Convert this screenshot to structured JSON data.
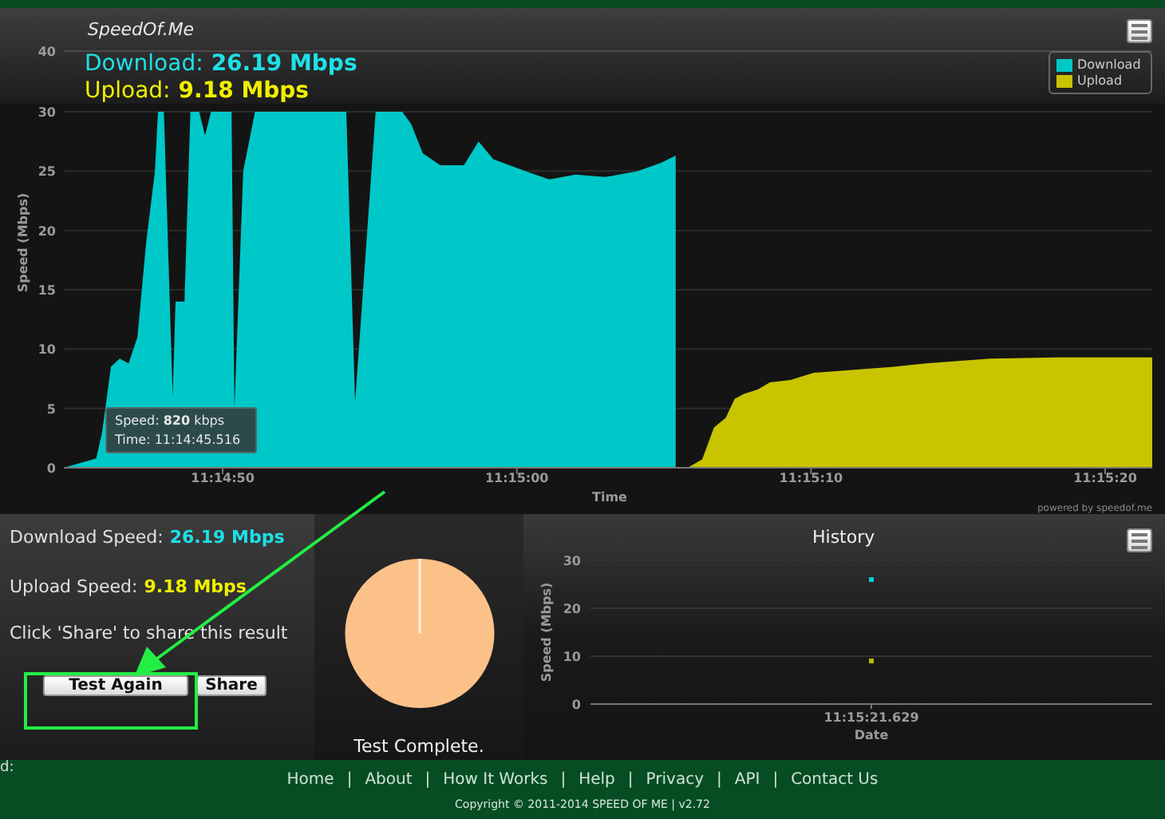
{
  "header": {
    "title": "SpeedOf.Me",
    "download": {
      "label": "Download:",
      "value": "26.19 Mbps"
    },
    "upload": {
      "label": "Upload:",
      "value": "9.18 Mbps"
    }
  },
  "speed_chart": {
    "chart_data": {
      "type": "area",
      "xlabel": "Time",
      "ylabel": "Speed (Mbps)",
      "x": [
        40484.6,
        40485.7,
        40485.9,
        40486.2,
        40486.5,
        40486.8,
        40487.1,
        40487.4,
        40487.7,
        40487.8,
        40488.0,
        40488.3,
        40488.4,
        40488.7,
        40488.9,
        40489.2,
        40489.4,
        40489.6,
        40490.3,
        40490.4,
        40490.7,
        40491.1,
        40494.2,
        40494.5,
        40495.2,
        40496.1,
        40496.4,
        40496.8,
        40497.4,
        40498.2,
        40498.7,
        40499.2,
        40500.3,
        40501.1,
        40502.0,
        40503.0,
        40504.1,
        40504.9,
        40505.4,
        40505.8,
        40506.3,
        40506.7,
        40507.1,
        40507.4,
        40507.7,
        40508.2,
        40508.6,
        40509.3,
        40510.1,
        40511.2,
        40512.8,
        40513.9,
        40515.0,
        40516.1,
        40518.3,
        40521.6
      ],
      "series": [
        {
          "name": "Download",
          "color": "#00c8c8",
          "values": [
            0,
            0.8,
            3,
            8.5,
            9.2,
            8.8,
            11,
            19,
            25,
            30,
            30,
            6,
            14,
            14,
            30,
            30,
            28,
            30,
            30,
            5,
            25,
            30,
            30,
            5.5,
            30,
            30,
            29,
            26.5,
            25.5,
            25.5,
            27.5,
            26,
            25,
            24.3,
            24.7,
            24.5,
            25,
            25.7,
            26.3,
            null,
            null,
            null,
            null,
            null,
            null,
            null,
            null,
            null,
            null,
            null,
            null,
            null,
            null,
            null,
            null,
            null
          ]
        },
        {
          "name": "Upload",
          "color": "#c8c400",
          "values": [
            null,
            null,
            null,
            null,
            null,
            null,
            null,
            null,
            null,
            null,
            null,
            null,
            null,
            null,
            null,
            null,
            null,
            null,
            null,
            null,
            null,
            null,
            null,
            null,
            null,
            null,
            null,
            null,
            null,
            null,
            null,
            null,
            null,
            null,
            null,
            null,
            null,
            null,
            null,
            0,
            0.7,
            3.4,
            4.2,
            5.8,
            6.2,
            6.6,
            7.2,
            7.4,
            8,
            8.2,
            8.5,
            8.8,
            9,
            9.2,
            9.3,
            9.3
          ]
        }
      ],
      "xlim": [
        40484.6,
        40521.6
      ],
      "ylim": [
        0,
        30
      ],
      "grid": true,
      "xticks": [
        {
          "value": 40490,
          "label": "11:14:50"
        },
        {
          "value": 40500,
          "label": "11:15:00"
        },
        {
          "value": 40510,
          "label": "11:15:10"
        },
        {
          "value": 40520,
          "label": "11:15:20"
        }
      ],
      "yticks": [
        0,
        5,
        10,
        15,
        20,
        25,
        30
      ],
      "annotations": [
        {
          "text": "40"
        }
      ]
    },
    "tooltip": {
      "speed": "Speed: **820** kbps",
      "time": "Time: 11:14:45.516"
    },
    "credit": "powered by speedof.me"
  },
  "results": {
    "download": {
      "label": "Download Speed:",
      "value": "26.19 Mbps"
    },
    "upload": {
      "label": "Upload Speed:",
      "value": "9.18 Mbps"
    },
    "hint": "Click 'Share' to share this result",
    "buttons": [
      "Test Again",
      "Share"
    ]
  },
  "progress": {
    "status": "Test Complete."
  },
  "history": {
    "title": "History",
    "chart_data": {
      "type": "scatter",
      "xlabel": "Date",
      "ylabel": "Speed (Mbps)",
      "series": [
        {
          "color": "#00d0d0",
          "values": [
            26
          ]
        },
        {
          "color": "#b8b800",
          "values": [
            9
          ]
        }
      ],
      "ylim": [
        0,
        30
      ],
      "yticks": [
        0,
        10,
        20,
        30
      ],
      "annotations": [
        "11:15:21.629"
      ]
    }
  },
  "footer": {
    "cut_text": "d:",
    "links": [
      "Home",
      "About",
      "How It Works",
      "Help",
      "Privacy",
      "API",
      "Contact Us"
    ],
    "separator": "|",
    "copyright": "Copyright © 2011-2014 SPEED OF ME | v2.72"
  }
}
